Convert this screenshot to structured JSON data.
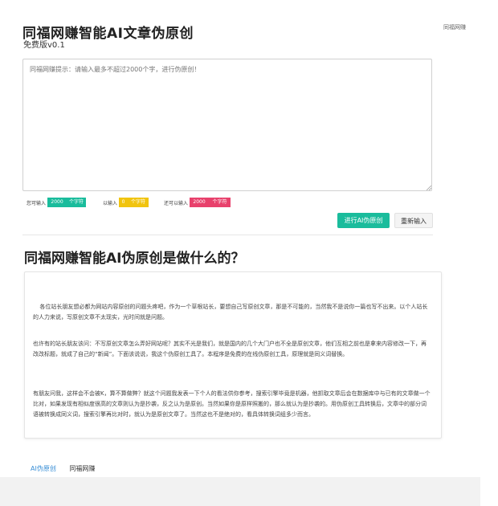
{
  "header": {
    "top_link": "同福网赚",
    "title": "同福网赚智能AI文章伪原创",
    "subtitle": "免费版v0.1"
  },
  "editor": {
    "placeholder": "同福网赚提示：请输入最多不超过2000个字，进行伪原创！"
  },
  "counters": [
    {
      "label": "您可输入",
      "value": "2000",
      "unit": "个字符",
      "color": "#1abc9c"
    },
    {
      "label": "以输入",
      "value": "0",
      "unit": "个字符",
      "color": "#f1c40f"
    },
    {
      "label": "还可以输入",
      "value": "2000",
      "unit": "个字符",
      "color": "#e8416c"
    }
  ],
  "buttons": {
    "process": "进行AI伪原创",
    "reset": "重新输入"
  },
  "section": {
    "title": "同福网赚智能AI伪原创是做什么的？",
    "paragraphs": [
      "各位站长朋友想必都为网站内容原创的问题头疼吧，作为一个草根站长，要想自己写原创文章，那是不可能的，当然我不是说你一篇也写不出来。以个人站长的人力来说，写原创文章不太现实，光时间就是问题。",
      "也许有的站长朋友该问：不写原创文章怎么弄好网站呢？其实不光是我们，就是国内的几个大门户也不全是原创文章，他们互相之前也是拿来内容修改一下，再改改标题，就成了自己的“新闻”。下面该说说，我这个伪原创工具了。本程序是免费的在线伪原创工具，原理就是同义词替换。",
      "有朋友问我，这样会不会被K，算不算做弊？就这个问题我发表一下个人的看法供你参考，搜索引擎毕竟是机器，他抓取文章后会在数据库中与已有的文章做一个比对，如果发现有相似度很高的文章则认为是抄袭，反之认为是原创。当然如果你是原样照搬的，那么就认为是抄袭的。用伪原创工具转换后，文章中的部分词语被转换成同义词，搜索引擎再比对时，就认为是原创文章了。当然这也不是绝对的，看具体转换词组多少而言。"
    ]
  },
  "footer": {
    "links": [
      {
        "label": "AI伪原创",
        "color": "#3a8fd6"
      },
      {
        "label": "同福网赚",
        "color": "#333333"
      }
    ]
  }
}
